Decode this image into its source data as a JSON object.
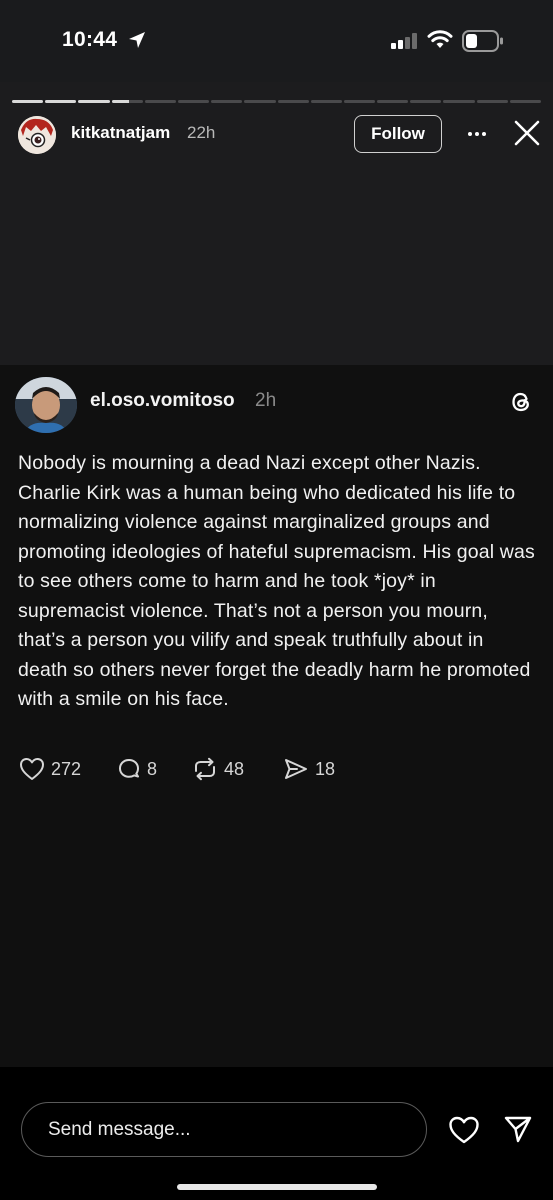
{
  "status_bar": {
    "time": "10:44",
    "icons": [
      "location-arrow-icon",
      "cellular-signal-icon",
      "wifi-icon",
      "battery-icon"
    ]
  },
  "story": {
    "username": "kitkatnatjam",
    "time_ago": "22h",
    "follow_label": "Follow",
    "segments_total": 16,
    "segments_complete": 3,
    "icons": [
      "more-icon",
      "close-icon"
    ]
  },
  "post": {
    "username": "el.oso.vomitoso",
    "time_ago": "2h",
    "text": "Nobody is mourning a dead Nazi except other Nazis. Charlie Kirk was a human being who dedicated his life to normalizing violence against marginalized groups and promoting ideologies of hateful supremacism. His goal was to see others come to harm and he took *joy* in supremacist violence. That’s not a person you mourn, that’s a person you vilify and speak truthfully about in death so others never forget the deadly harm he promoted with a smile on his face.",
    "likes": "272",
    "replies": "8",
    "reposts": "48",
    "shares": "18",
    "icons": [
      "threads-logo-icon",
      "heart-outline-icon",
      "comment-icon",
      "repost-icon",
      "send-icon"
    ]
  },
  "bottom_bar": {
    "message_placeholder": "Send message...",
    "icons": [
      "heart-icon",
      "direct-send-icon"
    ]
  },
  "colors": {
    "background": "#000000",
    "story_bg": "#1c1c1e",
    "card_bg": "#101010",
    "text": "#ffffff",
    "muted": "#8a8a8a"
  }
}
